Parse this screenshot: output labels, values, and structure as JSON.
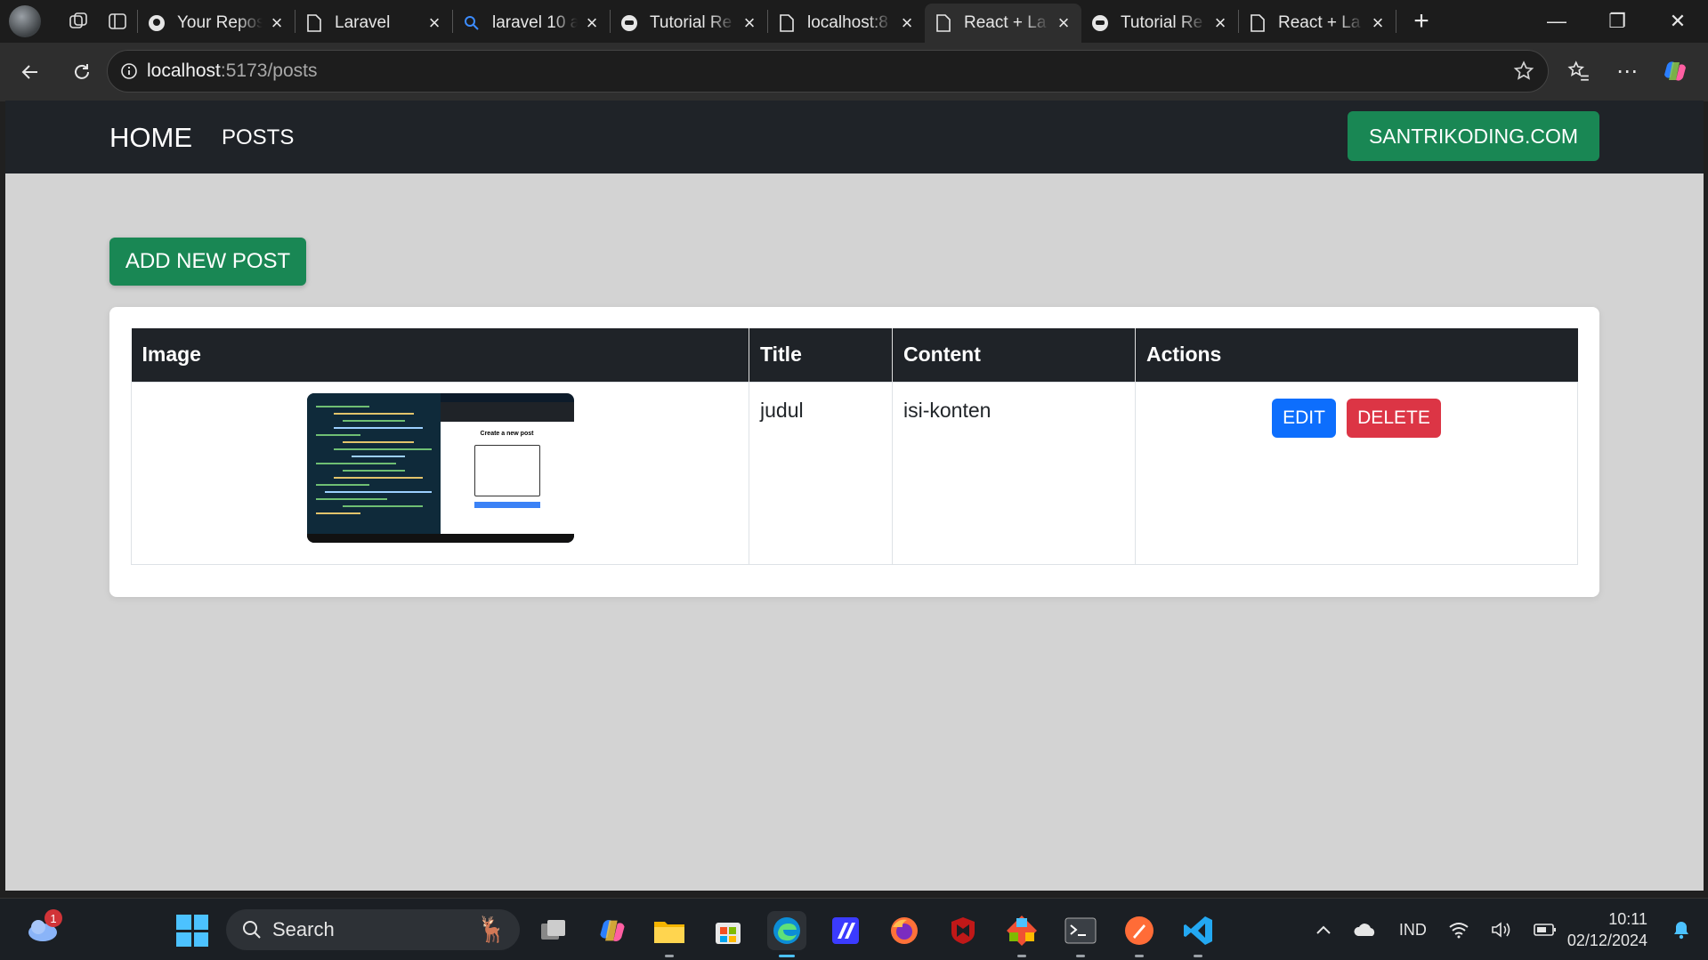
{
  "browser": {
    "tabs": [
      {
        "title": "Your Repos",
        "favicon": "github-icon",
        "active": false
      },
      {
        "title": "Laravel",
        "favicon": "page-icon",
        "active": false
      },
      {
        "title": "laravel 10 a",
        "favicon": "search-icon",
        "active": false
      },
      {
        "title": "Tutorial Re",
        "favicon": "site-icon",
        "active": false
      },
      {
        "title": "localhost:8",
        "favicon": "page-icon",
        "active": false
      },
      {
        "title": "React + La",
        "favicon": "page-icon",
        "active": true
      },
      {
        "title": "Tutorial Re",
        "favicon": "site-icon",
        "active": false
      },
      {
        "title": "React + La",
        "favicon": "page-icon",
        "active": false
      }
    ],
    "url_host": "localhost",
    "url_path": ":5173/posts"
  },
  "app": {
    "brand": "HOME",
    "nav_posts": "POSTS",
    "cta": "SANTRIKODING.COM",
    "add_button": "ADD NEW POST",
    "table": {
      "headers": [
        "Image",
        "Title",
        "Content",
        "Actions"
      ],
      "rows": [
        {
          "title": "judul",
          "content": "isi-konten",
          "edit": "EDIT",
          "delete": "DELETE",
          "thumb_heading": "Create a new post"
        }
      ]
    }
  },
  "taskbar": {
    "notification_count": "1",
    "search_label": "Search",
    "language": "IND",
    "time": "10:11",
    "date": "02/12/2024"
  },
  "colors": {
    "navbar": "#1f2328",
    "success": "#198754",
    "primary": "#0d6efd",
    "danger": "#dc3545",
    "page_bg": "#d3d3d3"
  }
}
